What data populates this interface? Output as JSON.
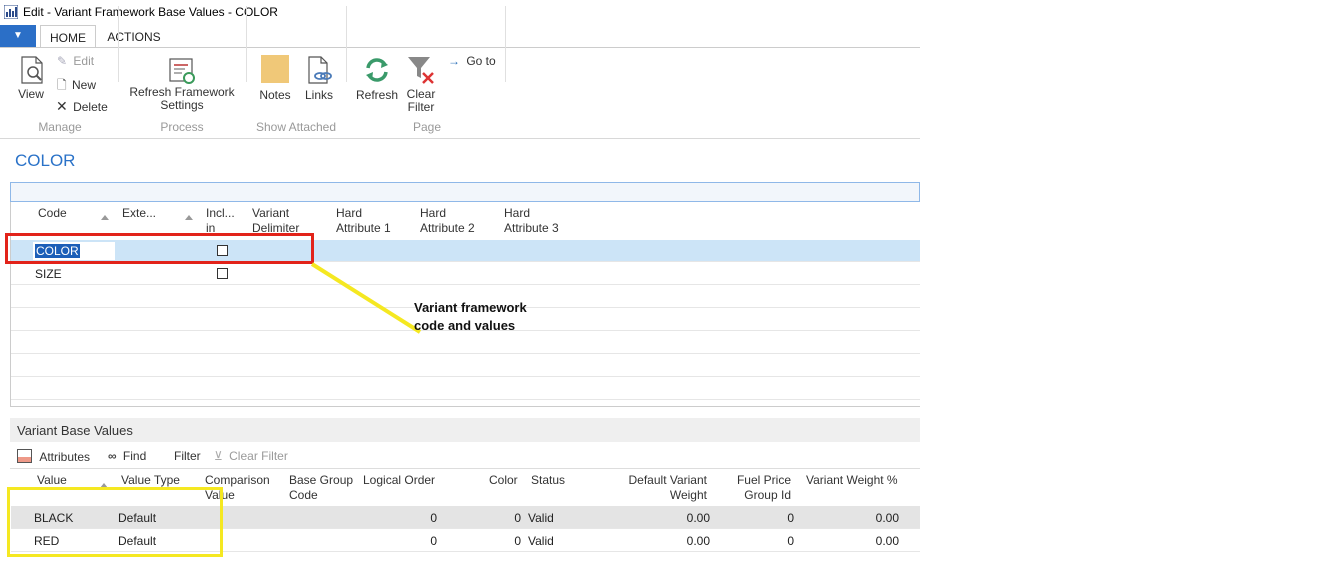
{
  "window": {
    "title": "Edit - Variant Framework Base Values - COLOR"
  },
  "ribbon": {
    "tabs": [
      {
        "label": "HOME"
      },
      {
        "label": "ACTIONS"
      }
    ],
    "manage": {
      "view": "View",
      "edit": "Edit",
      "new": "New",
      "delete": "Delete",
      "group": "Manage"
    },
    "process": {
      "refresh_settings": "Refresh Framework Settings",
      "group": "Process"
    },
    "attached": {
      "notes": "Notes",
      "links": "Links",
      "group": "Show Attached"
    },
    "page": {
      "refresh": "Refresh",
      "clear_filter": "Clear Filter",
      "goto": "Go to",
      "group": "Page"
    }
  },
  "page": {
    "title": "COLOR"
  },
  "frameworks": {
    "columns": {
      "code": "Code",
      "ext": "Exte...",
      "incl": "Incl... in",
      "delim": "Variant Delimiter",
      "hard1": "Hard Attribute 1",
      "hard2": "Hard Attribute 2",
      "hard3": "Hard Attribute 3"
    },
    "rows": [
      {
        "code": "COLOR",
        "included": false
      },
      {
        "code": "SIZE",
        "included": false
      }
    ]
  },
  "annotation": {
    "line1": "Variant framework",
    "line2": "code and values"
  },
  "base_values": {
    "title": "Variant Base Values",
    "toolbar": {
      "attributes": "Attributes",
      "find": "Find",
      "filter": "Filter",
      "clear_filter": "Clear Filter"
    },
    "columns": {
      "value": "Value",
      "value_type": "Value Type",
      "comparison": "Comparison Value",
      "base_group": "Base Group Code",
      "logical_order": "Logical Order",
      "color": "Color",
      "status": "Status",
      "default_weight": "Default Variant Weight",
      "fuel_group": "Fuel Price Group Id",
      "weight_pct": "Variant Weight %"
    },
    "rows": [
      {
        "value": "BLACK",
        "value_type": "Default",
        "logical_order": "0",
        "color": "0",
        "status": "Valid",
        "default_weight": "0.00",
        "fuel_group": "0",
        "weight_pct": "0.00"
      },
      {
        "value": "RED",
        "value_type": "Default",
        "logical_order": "0",
        "color": "0",
        "status": "Valid",
        "default_weight": "0.00",
        "fuel_group": "0",
        "weight_pct": "0.00"
      }
    ]
  },
  "colors": {
    "accent": "#2a72c8",
    "selected_row": "#cce4f7",
    "red_box": "#e2231a",
    "yellow_box": "#f5e821"
  }
}
